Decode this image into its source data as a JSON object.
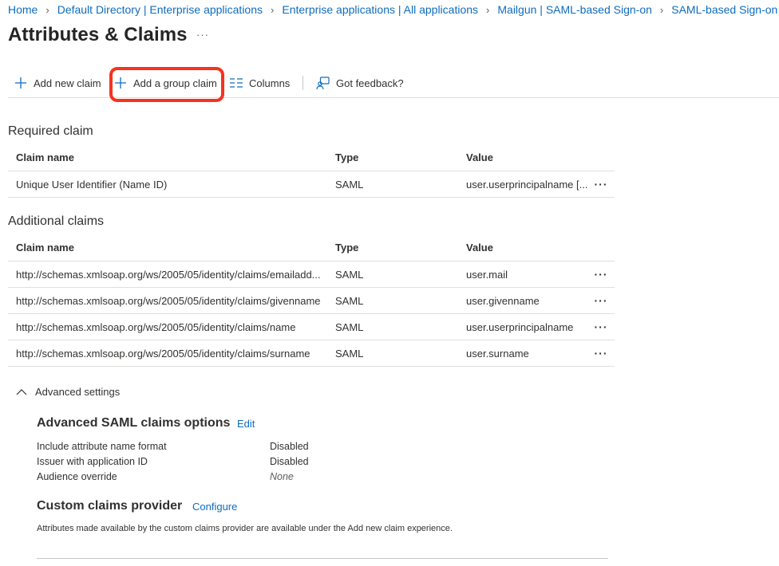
{
  "breadcrumb": {
    "items": [
      {
        "label": "Home"
      },
      {
        "label": "Default Directory | Enterprise applications"
      },
      {
        "label": "Enterprise applications | All applications"
      },
      {
        "label": "Mailgun | SAML-based Sign-on"
      },
      {
        "label": "SAML-based Sign-on"
      }
    ]
  },
  "page": {
    "title": "Attributes & Claims",
    "more": "···"
  },
  "toolbar": {
    "add_new_claim": "Add new claim",
    "add_group_claim": "Add a group claim",
    "columns": "Columns",
    "feedback": "Got feedback?",
    "highlight_color": "#f5331f"
  },
  "required": {
    "title": "Required claim",
    "headers": {
      "name": "Claim name",
      "type": "Type",
      "value": "Value"
    },
    "rows": [
      {
        "name": "Unique User Identifier (Name ID)",
        "type": "SAML",
        "value": "user.userprincipalname [...",
        "more": "···"
      }
    ]
  },
  "additional": {
    "title": "Additional claims",
    "headers": {
      "name": "Claim name",
      "type": "Type",
      "value": "Value"
    },
    "rows": [
      {
        "name": "http://schemas.xmlsoap.org/ws/2005/05/identity/claims/emailadd...",
        "type": "SAML",
        "value": "user.mail",
        "more": "···"
      },
      {
        "name": "http://schemas.xmlsoap.org/ws/2005/05/identity/claims/givenname",
        "type": "SAML",
        "value": "user.givenname",
        "more": "···"
      },
      {
        "name": "http://schemas.xmlsoap.org/ws/2005/05/identity/claims/name",
        "type": "SAML",
        "value": "user.userprincipalname",
        "more": "···"
      },
      {
        "name": "http://schemas.xmlsoap.org/ws/2005/05/identity/claims/surname",
        "type": "SAML",
        "value": "user.surname",
        "more": "···"
      }
    ]
  },
  "advanced": {
    "toggle_label": "Advanced settings",
    "saml_options": {
      "title": "Advanced SAML claims options",
      "edit": "Edit",
      "items": [
        {
          "label": "Include attribute name format",
          "value": "Disabled"
        },
        {
          "label": "Issuer with application ID",
          "value": "Disabled"
        },
        {
          "label": "Audience override",
          "value": "None"
        }
      ]
    },
    "custom_provider": {
      "title": "Custom claims provider",
      "configure": "Configure",
      "note": "Attributes made available by the custom claims provider are available under the Add new claim experience."
    }
  }
}
